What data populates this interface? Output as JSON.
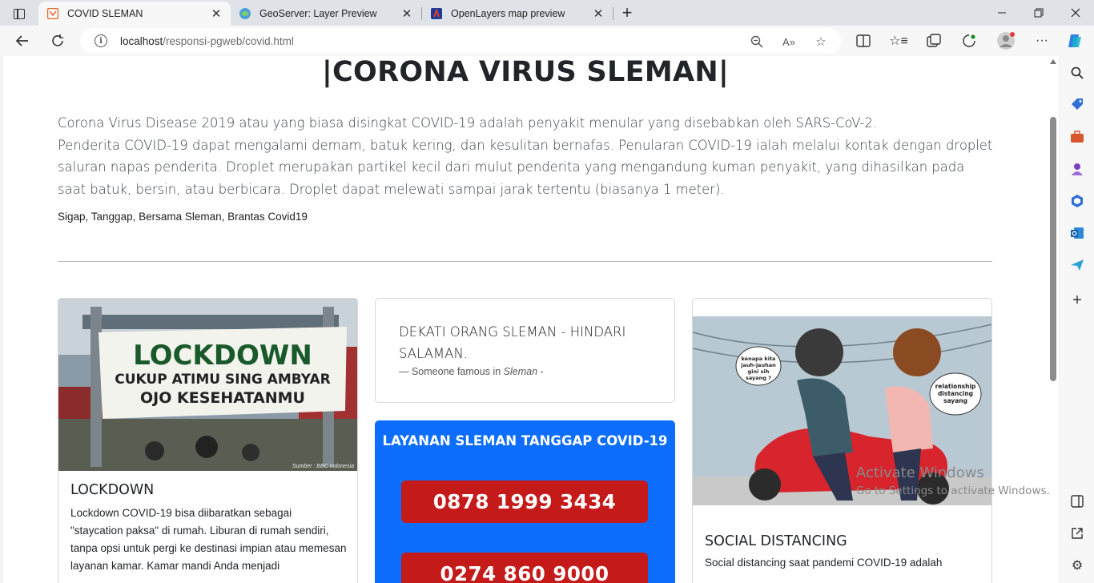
{
  "browser": {
    "tabs": [
      {
        "title": "COVID SLEMAN",
        "active": true,
        "favicon": "sleman-favicon"
      },
      {
        "title": "GeoServer: Layer Preview",
        "active": false,
        "favicon": "geoserver-favicon"
      },
      {
        "title": "OpenLayers map preview",
        "active": false,
        "favicon": "openlayers-favicon"
      }
    ],
    "address": {
      "host": "localhost",
      "path": "/responsi-pgweb/covid.html"
    },
    "window_controls": [
      "minimize-icon",
      "restore-icon",
      "close-icon"
    ]
  },
  "page": {
    "title": "|CORONA VIRUS SLEMAN|",
    "intro_lines": [
      "Corona Virus Disease 2019 atau yang biasa disingkat COVID-19 adalah penyakit menular yang disebabkan oleh SARS-CoV-2.",
      "Penderita COVID-19 dapat mengalami demam, batuk kering, dan kesulitan bernafas. Penularan COVID-19 ialah melalui kontak dengan droplet saluran napas penderita. Droplet merupakan partikel kecil dari mulut penderita yang mengandung kuman penyakit, yang dihasilkan pada saat batuk, bersin, atau berbicara. Droplet dapat melewati sampai jarak tertentu (biasanya 1 meter)."
    ],
    "tagline": "Sigap, Tanggap, Bersama Sleman, Brantas Covid19",
    "lockdown_card": {
      "banner_text_top": "LOCKDOWN",
      "banner_text_line1": "CUKUP ATIMU SING AMBYAR",
      "banner_text_line2": "OJO KESEHATANMU",
      "image_source": "Sumber : BBC Indonesia",
      "title": "LOCKDOWN",
      "text": "Lockdown COVID-19 bisa diibaratkan sebagai \"staycation paksa\" di rumah. Liburan di rumah sendiri, tanpa opsi untuk pergi ke destinasi impian atau memesan layanan kamar. Kamar mandi Anda menjadi"
    },
    "quote_card": {
      "quote": "DEKATI ORANG SLEMAN - HINDARI SALAMAN.",
      "footer_prefix": "— Someone famous in",
      "footer_source": "Sleman",
      "footer_suffix": " -"
    },
    "hotline_card": {
      "title": "LAYANAN SLEMAN TANGGAP COVID-19",
      "phones": [
        "0878 1999 3434",
        "0274 860 9000"
      ]
    },
    "social_card": {
      "bubble_left": [
        "kenapa kita",
        "jauh-jauhan",
        "gini sih",
        "sayang ?"
      ],
      "bubble_right": [
        "relationship",
        "distancing",
        "sayang"
      ],
      "title": "SOCIAL DISTANCING",
      "text": "Social distancing saat pandemi COVID-19 adalah"
    }
  },
  "watermark": {
    "line1": "Activate Windows",
    "line2": "Go to Settings to activate Windows."
  },
  "colors": {
    "primary": "#0d6efd",
    "danger": "#c51a1a"
  }
}
